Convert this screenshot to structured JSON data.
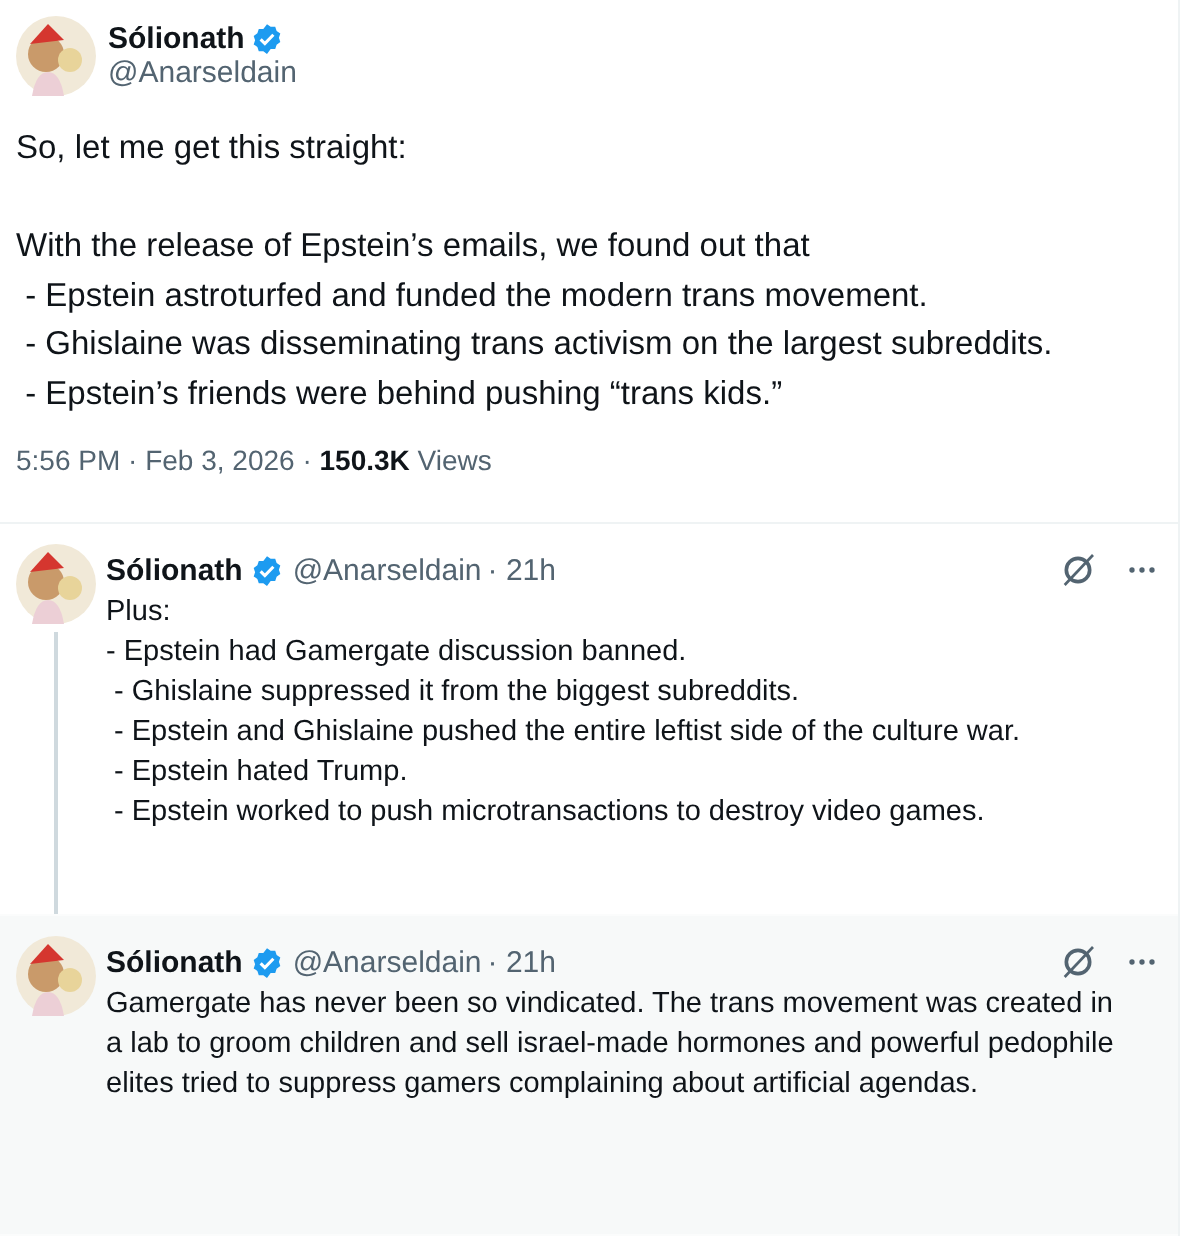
{
  "tweet": {
    "author": {
      "name": "Sólionath",
      "handle": "@Anarseldain",
      "verified": true
    },
    "text": "So, let me get this straight:\n\nWith the release of Epstein’s emails, we found out that\n - Epstein astroturfed and funded the modern trans movement.\n - Ghislaine was disseminating trans activism on the largest subreddits.\n - Epstein’s friends were behind pushing “trans kids.”",
    "time": "5:56 PM · Feb 3, 2026 · ",
    "views_count": "150.3K",
    "views_label": " Views"
  },
  "replies": [
    {
      "author": {
        "name": "Sólionath",
        "handle": "@Anarseldain",
        "verified": true
      },
      "age": "· 21h",
      "thread_line": true,
      "highlighted": false,
      "text": "Plus:\n- Epstein had Gamergate discussion banned.\n - Ghislaine suppressed it from the biggest subreddits.\n - Epstein and Ghislaine pushed the entire leftist side of the culture war.\n - Epstein hated Trump.\n - Epstein worked to push microtransactions to destroy video games."
    },
    {
      "author": {
        "name": "Sólionath",
        "handle": "@Anarseldain",
        "verified": true
      },
      "age": "· 21h",
      "thread_line": false,
      "highlighted": true,
      "text": "Gamergate has never been so vindicated. The trans movement was created in a lab to groom children and sell israel-made hormones and powerful pedophile elites tried to suppress gamers complaining about artificial agendas."
    }
  ]
}
